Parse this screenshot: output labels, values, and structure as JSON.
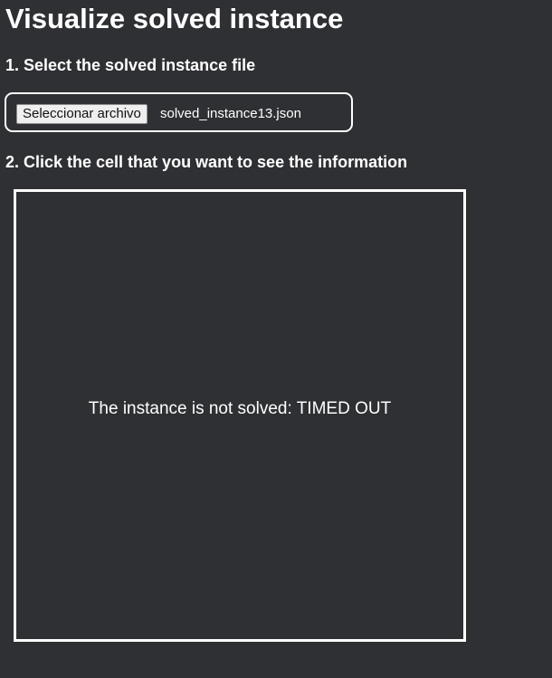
{
  "page": {
    "title": "Visualize solved instance"
  },
  "step1": {
    "heading": "1. Select the solved instance file",
    "file_button_label": "Seleccionar archivo",
    "selected_file": "solved_instance13.json"
  },
  "step2": {
    "heading": "2. Click the cell that you want to see the information",
    "status_message": "The instance is not solved: TIMED OUT"
  },
  "colors": {
    "background": "#2f3033",
    "foreground": "#ffffff",
    "button_background": "#efefef"
  }
}
